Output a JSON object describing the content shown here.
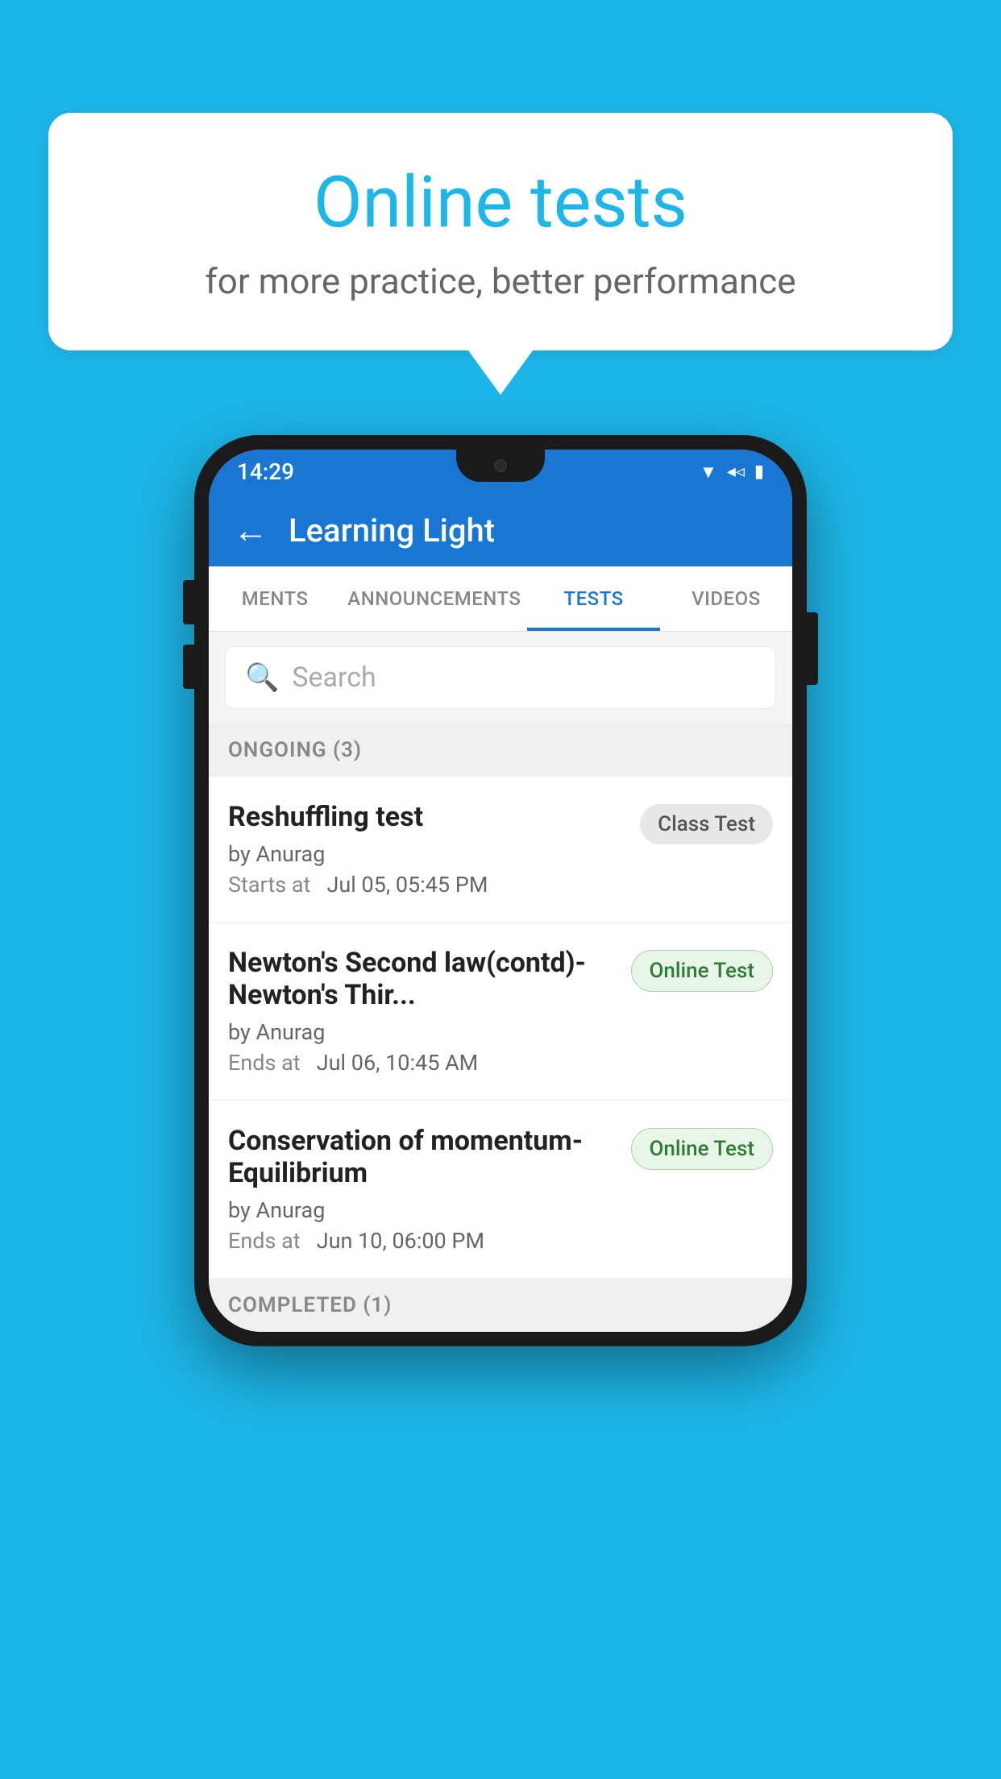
{
  "background": {
    "color": "#1DB6E8"
  },
  "speech_bubble": {
    "title": "Online tests",
    "subtitle": "for more practice, better performance"
  },
  "phone": {
    "status_bar": {
      "time": "14:29",
      "icons": [
        "wifi",
        "signal",
        "battery"
      ]
    },
    "app_bar": {
      "title": "Learning Light",
      "back_label": "←"
    },
    "tabs": [
      {
        "label": "MENTS",
        "active": false
      },
      {
        "label": "ANNOUNCEMENTS",
        "active": false
      },
      {
        "label": "TESTS",
        "active": true
      },
      {
        "label": "VIDEOS",
        "active": false
      }
    ],
    "search": {
      "placeholder": "Search"
    },
    "ongoing_section": {
      "label": "ONGOING (3)"
    },
    "tests": [
      {
        "name": "Reshuffling test",
        "author": "by Anurag",
        "time_label": "Starts at",
        "time_value": "Jul 05, 05:45 PM",
        "badge": "Class Test",
        "badge_type": "class"
      },
      {
        "name": "Newton's Second law(contd)-Newton's Thir...",
        "author": "by Anurag",
        "time_label": "Ends at",
        "time_value": "Jul 06, 10:45 AM",
        "badge": "Online Test",
        "badge_type": "online"
      },
      {
        "name": "Conservation of momentum-Equilibrium",
        "author": "by Anurag",
        "time_label": "Ends at",
        "time_value": "Jun 10, 06:00 PM",
        "badge": "Online Test",
        "badge_type": "online"
      }
    ],
    "completed_section": {
      "label": "COMPLETED (1)"
    }
  }
}
